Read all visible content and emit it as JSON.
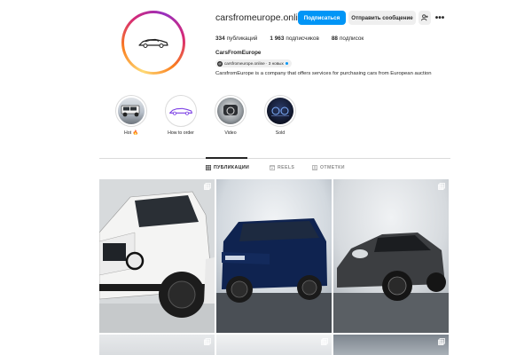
{
  "profile": {
    "username": "carsfromeurope.online",
    "display_name": "CarsFromEurope",
    "bio": "CarsfromEurope is a company that offers services for purchasing cars from European auction",
    "threads_handle": "carsfromeurope.online · 3 новых"
  },
  "actions": {
    "follow_label": "Подписаться",
    "message_label": "Отправить сообщение",
    "suggest_icon": "add-person-icon",
    "more_label": "•••"
  },
  "stats": {
    "posts_count": "334",
    "posts_label": "публикаций",
    "followers_count": "1 963",
    "followers_label": "подписчиков",
    "following_count": "88",
    "following_label": "подписок"
  },
  "highlights": [
    {
      "label": "Hot 🔥",
      "icon": "mercedes-g-class-thumb"
    },
    {
      "label": "How to order",
      "icon": "car-logo-thumb"
    },
    {
      "label": "Video",
      "icon": "car-interior-thumb"
    },
    {
      "label": "Sold",
      "icon": "dashboard-thumb"
    }
  ],
  "tabs": [
    {
      "label": "ПУБЛИКАЦИИ",
      "icon": "grid-icon",
      "active": true
    },
    {
      "label": "REELS",
      "icon": "reels-icon",
      "active": false
    },
    {
      "label": "ОТМЕТКИ",
      "icon": "tagged-icon",
      "active": false
    }
  ],
  "posts": [
    {
      "subject": "white-mercedes-g-class",
      "icon": "multiple-photos-icon"
    },
    {
      "subject": "blue-range-rover",
      "icon": "multiple-photos-icon"
    },
    {
      "subject": "grey-porsche-911",
      "icon": "multiple-photos-icon"
    }
  ],
  "colors": {
    "accent": "#0095f6",
    "text": "#262626",
    "muted": "#8e8e8e",
    "border": "#dbdbdb"
  }
}
